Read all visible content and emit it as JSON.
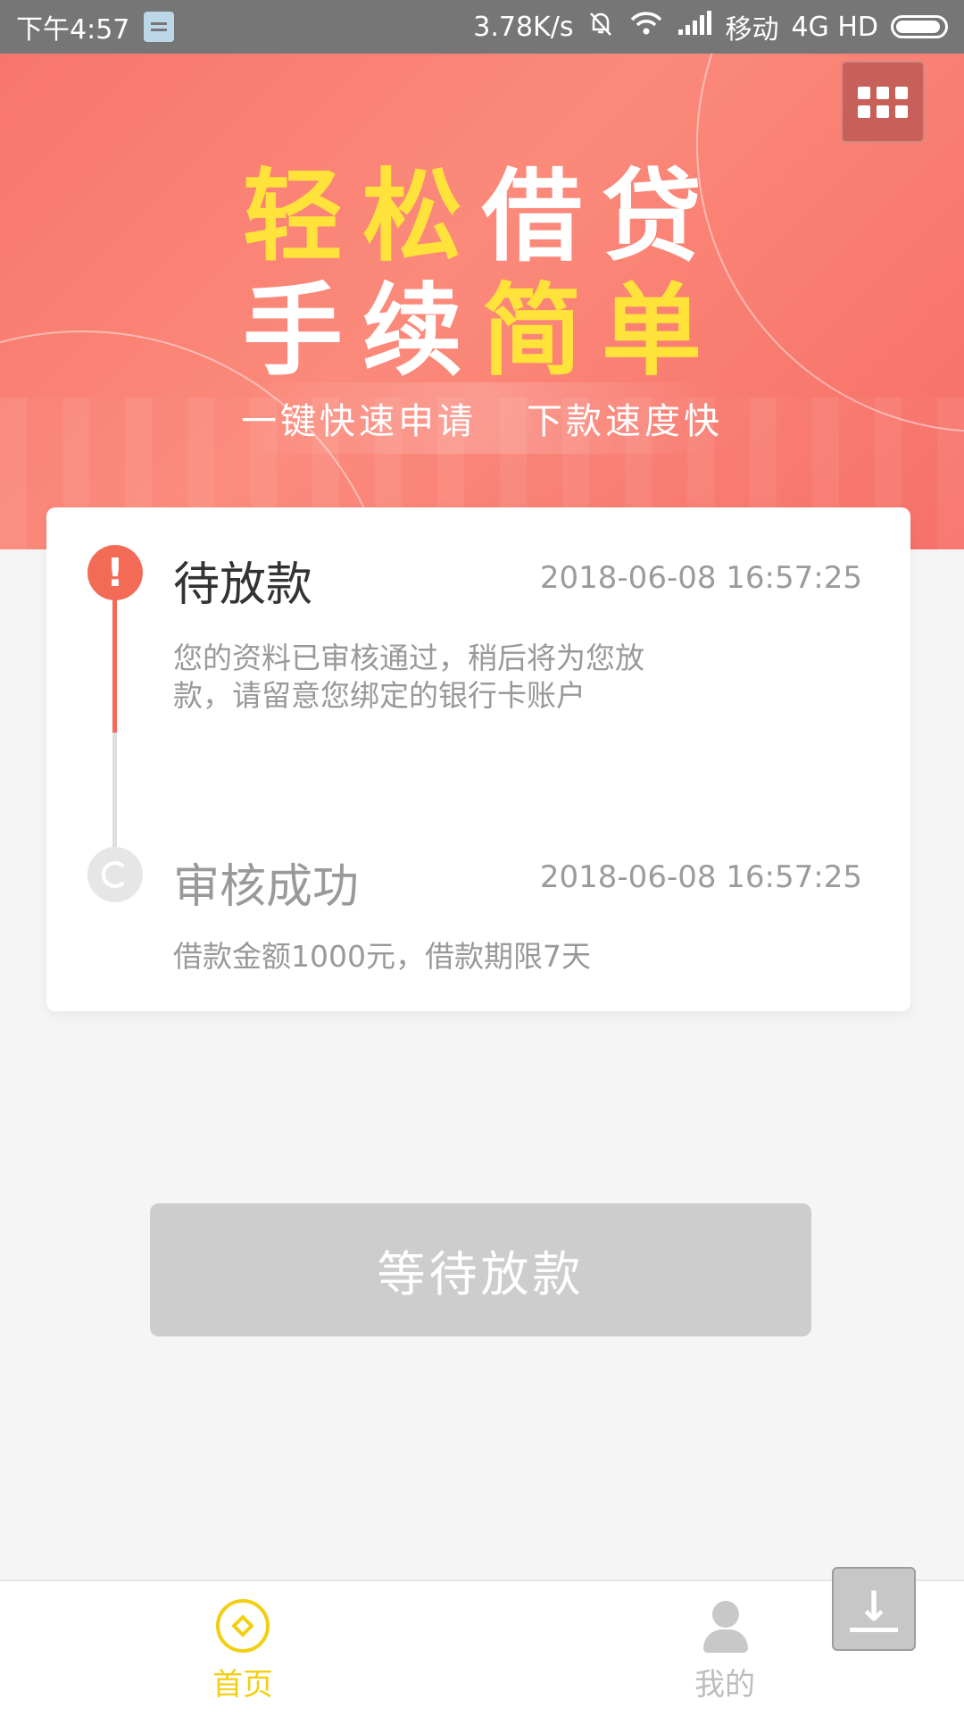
{
  "status_bar": {
    "time": "下午4:57",
    "speed": "3.78K/s",
    "carrier": "移动",
    "network": "4G HD",
    "icons": [
      "message-icon",
      "mute-icon",
      "wifi-icon",
      "signal-icon",
      "battery-icon"
    ]
  },
  "banner": {
    "headline_line1_part_a": "轻松",
    "headline_line1_part_b": "借贷",
    "headline_line2_part_a": "手续",
    "headline_line2_part_b": "简单",
    "slogan_left": "一键快速申请",
    "slogan_right": "下款速度快",
    "accent_color": "#ffe33b"
  },
  "timeline": {
    "steps": [
      {
        "title": "待放款",
        "time": "2018-06-08 16:57:25",
        "description": "您的资料已审核通过，稍后将为您放款，请留意您绑定的银行卡账户",
        "status": "active",
        "icon": "alert-icon"
      },
      {
        "title": "审核成功",
        "time": "2018-06-08 16:57:25",
        "description": "借款金额1000元，借款期限7天",
        "status": "done",
        "icon": "refresh-icon"
      }
    ],
    "active_color": "#f36b57"
  },
  "action": {
    "label": "等待放款"
  },
  "tabbar": {
    "home_label": "首页",
    "mine_label": "我的",
    "active_color": "#f3ce12"
  }
}
